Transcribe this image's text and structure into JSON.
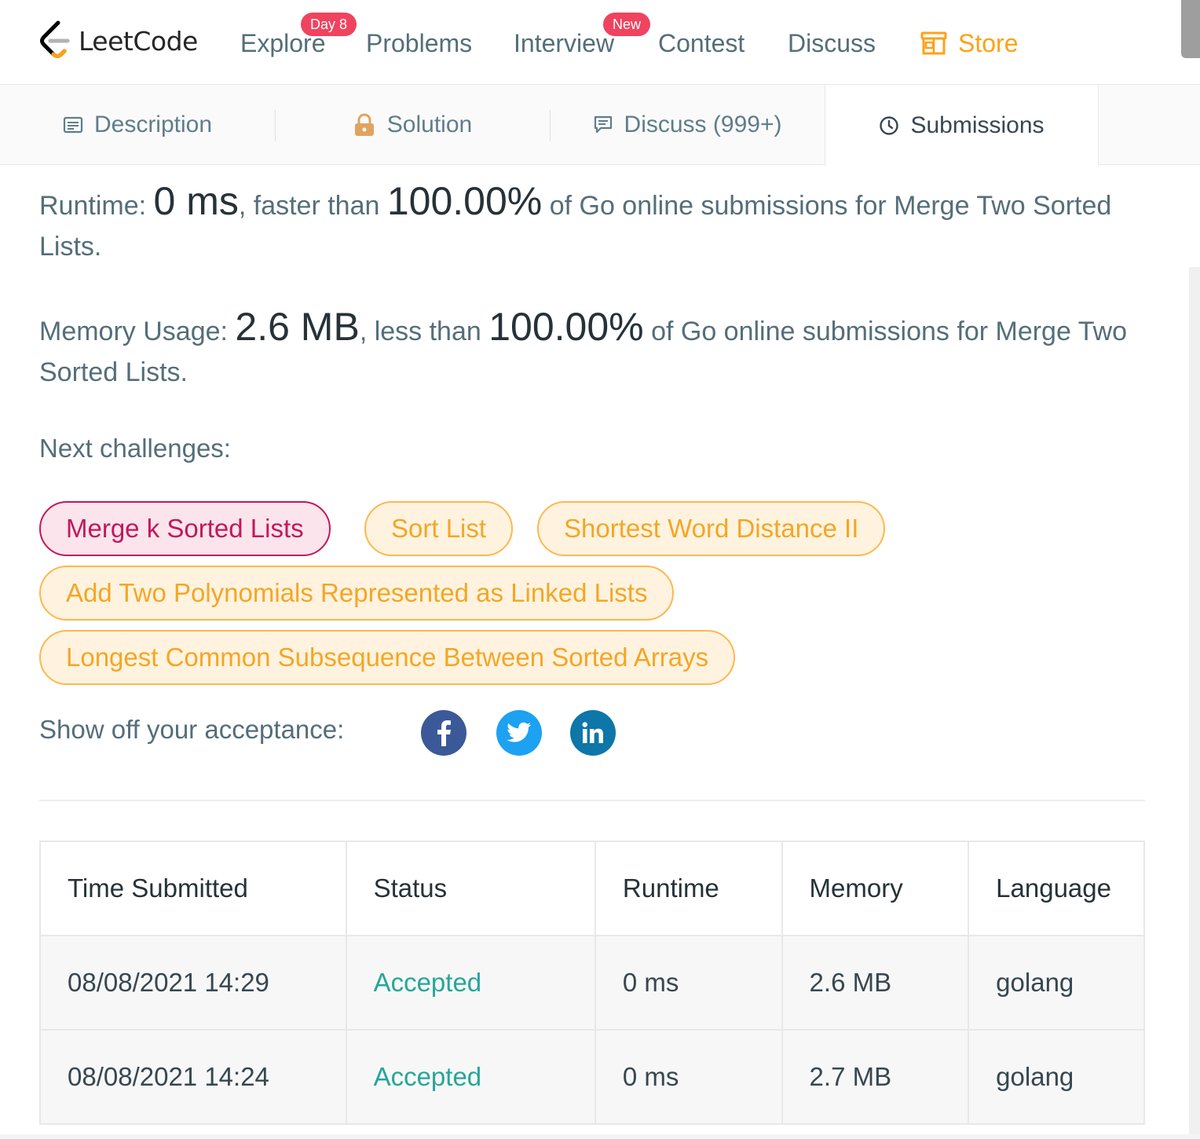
{
  "nav": {
    "logo_text": "LeetCode",
    "explore": "Explore",
    "explore_badge": "Day 8",
    "problems": "Problems",
    "interview": "Interview",
    "interview_badge": "New",
    "contest": "Contest",
    "discuss": "Discuss",
    "store": "Store",
    "store_color": "#ffa116",
    "badge_color": "#f0435f"
  },
  "tabs": {
    "description": "Description",
    "solution": "Solution",
    "discuss": "Discuss (999+)",
    "submissions": "Submissions",
    "active": "Submissions"
  },
  "result": {
    "runtime_label": "Runtime: ",
    "runtime_value": "0 ms",
    "runtime_mid": ", faster than ",
    "runtime_percent": "100.00%",
    "runtime_tail": " of Go online submissions for Merge Two Sorted Lists.",
    "memory_label": "Memory Usage: ",
    "memory_value": "2.6 MB",
    "memory_mid": ", less than ",
    "memory_percent": "100.00%",
    "memory_tail": " of Go online submissions for Merge Two Sorted Lists."
  },
  "next_challenges": {
    "label": "Next challenges:",
    "items": [
      {
        "title": "Merge k Sorted Lists",
        "difficulty": "hard"
      },
      {
        "title": "Sort List",
        "difficulty": "medium"
      },
      {
        "title": "Shortest Word Distance II",
        "difficulty": "medium"
      },
      {
        "title": "Add Two Polynomials Represented as Linked Lists",
        "difficulty": "medium"
      },
      {
        "title": "Longest Common Subsequence Between Sorted Arrays",
        "difficulty": "medium"
      }
    ]
  },
  "share": {
    "label": "Show off your acceptance:",
    "facebook_icon": "facebook-icon",
    "twitter_icon": "twitter-icon",
    "linkedin_icon": "linkedin-icon",
    "facebook_color": "#3b5998",
    "twitter_color": "#1da1f2",
    "linkedin_color": "#0e76a8"
  },
  "submissions_table": {
    "headers": [
      "Time Submitted",
      "Status",
      "Runtime",
      "Memory",
      "Language"
    ],
    "rows": [
      {
        "time": "08/08/2021 14:29",
        "status": "Accepted",
        "runtime": "0 ms",
        "memory": "2.6 MB",
        "language": "golang"
      },
      {
        "time": "08/08/2021 14:24",
        "status": "Accepted",
        "runtime": "0 ms",
        "memory": "2.7 MB",
        "language": "golang"
      }
    ],
    "accepted_color": "#26a69a"
  }
}
